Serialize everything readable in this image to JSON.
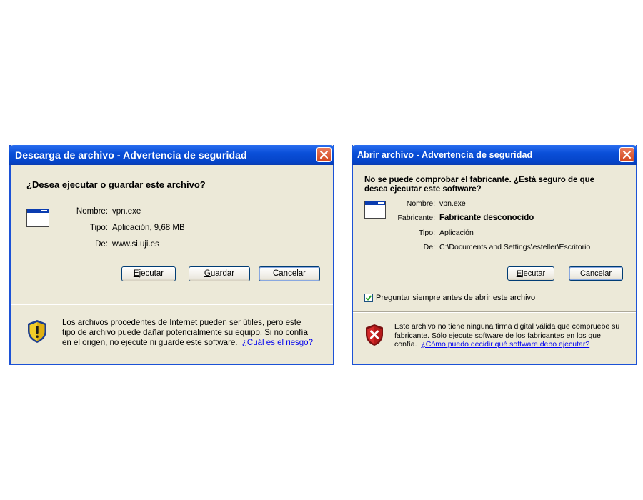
{
  "dialog1": {
    "title": "Descarga de archivo - Advertencia de seguridad",
    "question": "¿Desea ejecutar o guardar este archivo?",
    "fields": [
      {
        "label": "Nombre:",
        "value": "vpn.exe"
      },
      {
        "label": "Tipo:",
        "value": "Aplicación, 9,68 MB"
      },
      {
        "label": "De:",
        "value": "www.si.uji.es"
      }
    ],
    "buttons": {
      "run": {
        "mnemonic": "E",
        "rest": "jecutar"
      },
      "save": {
        "mnemonic": "G",
        "rest": "uardar"
      },
      "cancel": "Cancelar"
    },
    "warning_lines": [
      "Los archivos procedentes de Internet pueden ser útiles, pero este",
      "tipo de archivo puede dañar potencialmente su equipo. Si no confía",
      "en el origen, no ejecute ni guarde este software."
    ],
    "warning_link": "¿Cuál es el riesgo?",
    "icons": {
      "file": "application-file-icon",
      "shield": "shield-warning-icon",
      "close": "close-icon"
    }
  },
  "dialog2": {
    "title": "Abrir archivo - Advertencia de seguridad",
    "heading_lines": [
      "No se puede comprobar el fabricante. ¿Está seguro de que",
      "desea ejecutar este software?"
    ],
    "fields": [
      {
        "label": "Nombre:",
        "value": "vpn.exe"
      },
      {
        "label": "Fabricante:",
        "value": "Fabricante desconocido"
      },
      {
        "label": "Tipo:",
        "value": "Aplicación"
      },
      {
        "label": "De:",
        "value": "C:\\Documents and Settings\\esteller\\Escritorio"
      }
    ],
    "buttons": {
      "run": {
        "mnemonic": "E",
        "rest": "jecutar"
      },
      "cancel": "Cancelar"
    },
    "checkbox": {
      "checked": true,
      "mnemonic": "P",
      "rest": "reguntar siempre antes de abrir este archivo"
    },
    "warning_lines": [
      "Este archivo no tiene ninguna firma digital válida que compruebe su",
      "fabricante.  Sólo ejecute software de los fabricantes en los que",
      "confía."
    ],
    "warning_link": "¿Cómo puedo decidir qué software debo ejecutar?",
    "icons": {
      "file": "application-file-icon",
      "shield": "shield-error-icon",
      "close": "close-icon"
    }
  },
  "colors": {
    "title_blue": "#0a4fd8",
    "dialog_bg": "#ece9d8",
    "close_red": "#d2461f",
    "link": "#0000ee"
  }
}
